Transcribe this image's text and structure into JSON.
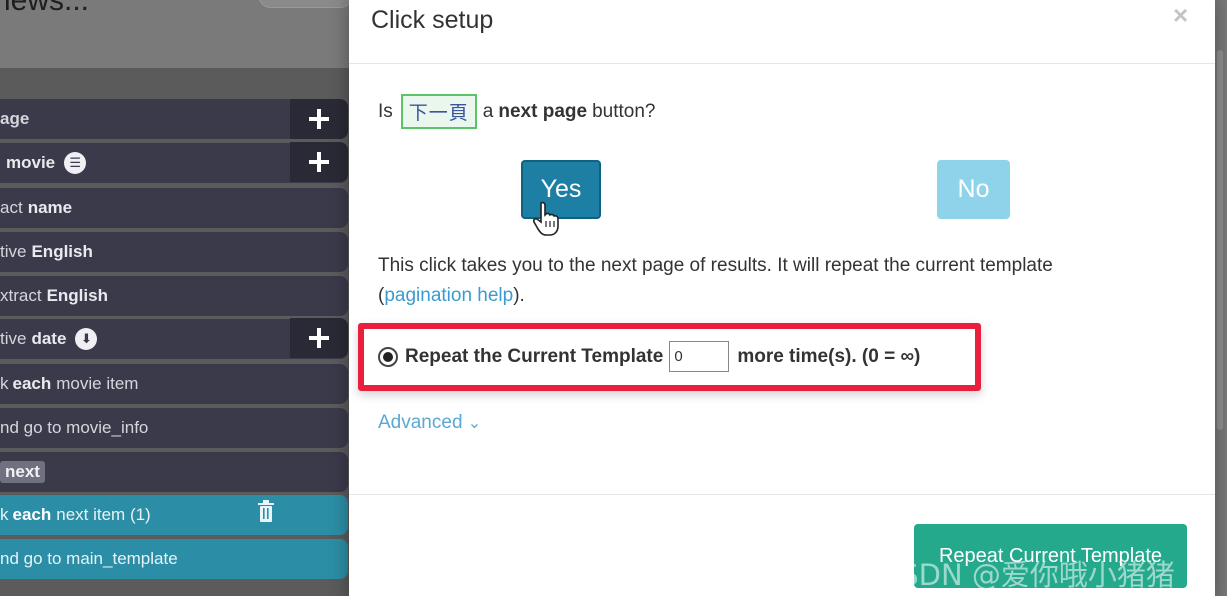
{
  "background_app": {
    "title_fragment": "iews..."
  },
  "sidebar": {
    "commands": [
      {
        "prefix": "age",
        "value": "",
        "badge": "",
        "icon": "",
        "style": "dark"
      },
      {
        "prefix": "",
        "value": "movie",
        "badge": "",
        "icon": "list-icon",
        "style": "dark"
      },
      {
        "prefix": "act",
        "value": "name",
        "badge": "",
        "icon": "",
        "style": "dark"
      },
      {
        "prefix": "tive",
        "value": "English",
        "badge": "",
        "icon": "",
        "style": "dark"
      },
      {
        "prefix": "xtract",
        "value": "English",
        "badge": "",
        "icon": "",
        "style": "dark"
      },
      {
        "prefix": "tive",
        "value": "date",
        "badge": "",
        "icon": "download-icon",
        "style": "dark"
      },
      {
        "prefix": "k",
        "value": "each",
        "suffix": "movie item",
        "style": "dark"
      },
      {
        "prefix": "nd go to movie_info",
        "value": "",
        "style": "dark"
      },
      {
        "prefix": "",
        "value": "",
        "badge": "next",
        "style": "dark"
      },
      {
        "prefix": "k",
        "value": "each",
        "suffix": "next item (1)",
        "style": "blue"
      },
      {
        "prefix": "nd go to main_template",
        "value": "",
        "style": "blue"
      }
    ]
  },
  "modal": {
    "title": "Click setup",
    "close_glyph": "×",
    "question": {
      "pre": "Is",
      "element_text": "下一頁",
      "mid": "a",
      "bold": "next page",
      "post": "button?"
    },
    "yes_label": "Yes",
    "no_label": "No",
    "explanation": "This click takes you to the next page of results. It will repeat the current template",
    "explanation_open": "(",
    "help_link": "pagination help",
    "explanation_close": ").",
    "repeat": {
      "label": "Repeat the Current Template",
      "value": "0",
      "suffix": "more time(s). (0 = ∞)",
      "selected": true
    },
    "advanced_label": "Advanced",
    "advanced_chevron": "⌄",
    "primary_button_label": "Repeat Current Template"
  },
  "watermark": "CSDN @爱你哦小猪猪",
  "colors": {
    "yes": "#1d7fa4",
    "no": "#8fd3ea",
    "primary": "#24a98c",
    "highlight": "#e8203d",
    "link": "#3a9bd0",
    "sidebar_dark": "#3a3a4b",
    "sidebar_blue": "#2c8ea6"
  }
}
